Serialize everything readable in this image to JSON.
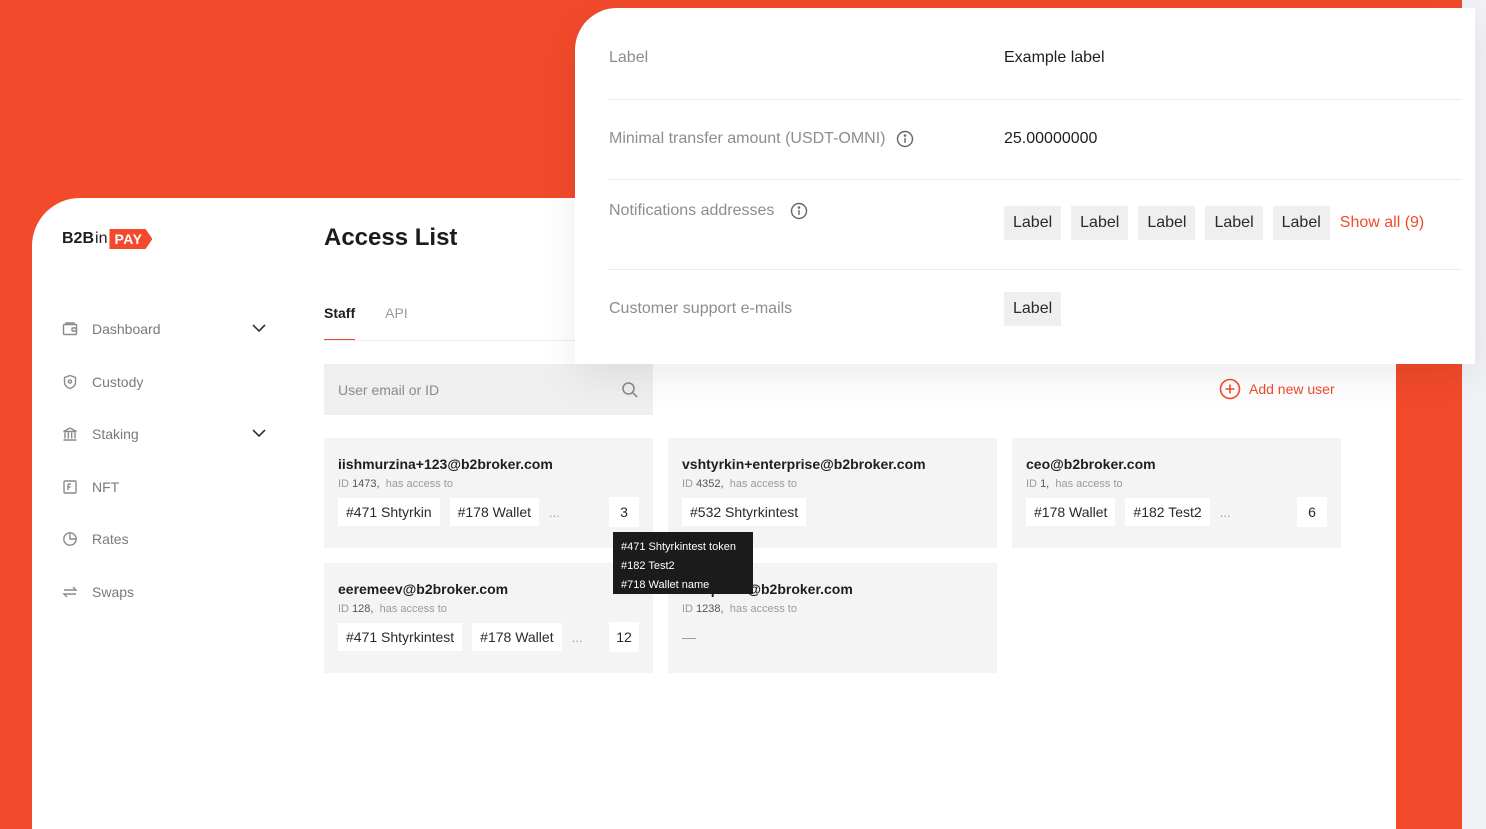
{
  "brand": {
    "left": "B2B",
    "middle": "in",
    "right": "PAY",
    "accent": "#f24a2b"
  },
  "sidebar": {
    "items": [
      {
        "label": "Dashboard",
        "icon": "wallet-icon",
        "expandable": true
      },
      {
        "label": "Custody",
        "icon": "shield-icon",
        "expandable": false
      },
      {
        "label": "Staking",
        "icon": "bank-icon",
        "expandable": true
      },
      {
        "label": "NFT",
        "icon": "nft-icon",
        "expandable": false
      },
      {
        "label": "Rates",
        "icon": "pie-chart-icon",
        "expandable": false
      },
      {
        "label": "Swaps",
        "icon": "swap-icon",
        "expandable": false
      }
    ]
  },
  "main": {
    "title": "Access List",
    "tabs": [
      {
        "label": "Staff",
        "active": true
      },
      {
        "label": "API",
        "active": false
      }
    ],
    "search": {
      "placeholder": "User email or ID"
    },
    "add_user_label": "Add new user",
    "cards": [
      {
        "email": "iishmurzina+123@b2broker.com",
        "id_label": "ID",
        "id": "1473,",
        "access_text": "has access to",
        "chips": [
          "#471 Shtyrkin",
          "#178 Wallet"
        ],
        "more": "...",
        "count": "3"
      },
      {
        "email": "vshtyrkin+enterprise@b2broker.com",
        "id_label": "ID",
        "id": "4352,",
        "access_text": "has access to",
        "chips": [
          "#532 Shtyrkintest"
        ],
        "more": "",
        "count": ""
      },
      {
        "email": "ceo@b2broker.com",
        "id_label": "ID",
        "id": "1,",
        "access_text": "has access to",
        "chips": [
          "#178 Wallet",
          "#182 Test2"
        ],
        "more": "...",
        "count": "6"
      },
      {
        "email": "eeremeev@b2broker.com",
        "id_label": "ID",
        "id": "128,",
        "access_text": "has access to",
        "chips": [
          "#471 Shtyrkintest",
          "#178 Wallet"
        ],
        "more": "...",
        "count": "12"
      },
      {
        "email": "o.shpilnik@b2broker.com",
        "id_label": "ID",
        "id": "1238,",
        "access_text": "has access to",
        "chips": [],
        "more": "",
        "count": "",
        "empty": "—"
      }
    ],
    "tooltip_lines": [
      "#471 Shtyrkintest token",
      "#182 Test2",
      "#718 Wallet name"
    ]
  },
  "overlay": {
    "rows": [
      {
        "label": "Label",
        "value": "Example label"
      },
      {
        "label": "Minimal transfer amount (USDT-OMNI)",
        "value": "25.00000000",
        "info": true
      },
      {
        "label": "Notifications addresses",
        "info": true,
        "chips": [
          "Label",
          "Label",
          "Label",
          "Label",
          "Label"
        ],
        "show_all": "Show all (9)"
      },
      {
        "label": "Customer support e-mails",
        "chips": [
          "Label"
        ]
      }
    ]
  }
}
